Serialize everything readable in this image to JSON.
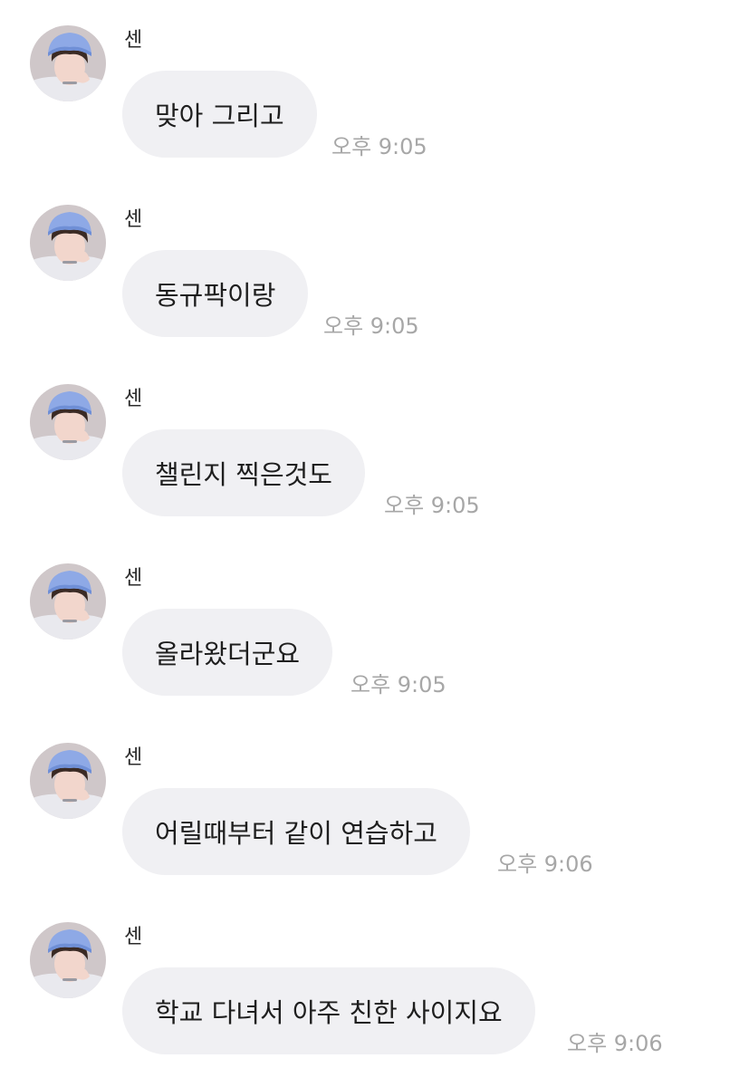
{
  "messages": [
    {
      "sender": "센",
      "text": "맞아 그리고",
      "time": "오후 9:05"
    },
    {
      "sender": "센",
      "text": "동규팍이랑",
      "time": "오후 9:05"
    },
    {
      "sender": "센",
      "text": "챌린지 찍은것도",
      "time": "오후 9:05"
    },
    {
      "sender": "센",
      "text": "올라왔더군요",
      "time": "오후 9:05"
    },
    {
      "sender": "센",
      "text": "어릴때부터 같이 연습하고",
      "time": "오후 9:06"
    },
    {
      "sender": "센",
      "text": "학교 다녀서 아주 친한 사이지요",
      "time": "오후 9:06"
    }
  ],
  "avatar": {
    "icon": "profile-photo-icon",
    "colors": {
      "hat": "#8ea9e6",
      "hat_shade": "#6f8fd6",
      "skin": "#f2d6cc",
      "hair": "#3a2a24",
      "shirt": "#e9e9ee",
      "background": "#cfc7c9"
    }
  },
  "colors": {
    "bubble": "#f0f0f3",
    "message_text": "#1e1e1e",
    "time_text": "#a7a7a7",
    "sender_text": "#2b2b2b"
  }
}
